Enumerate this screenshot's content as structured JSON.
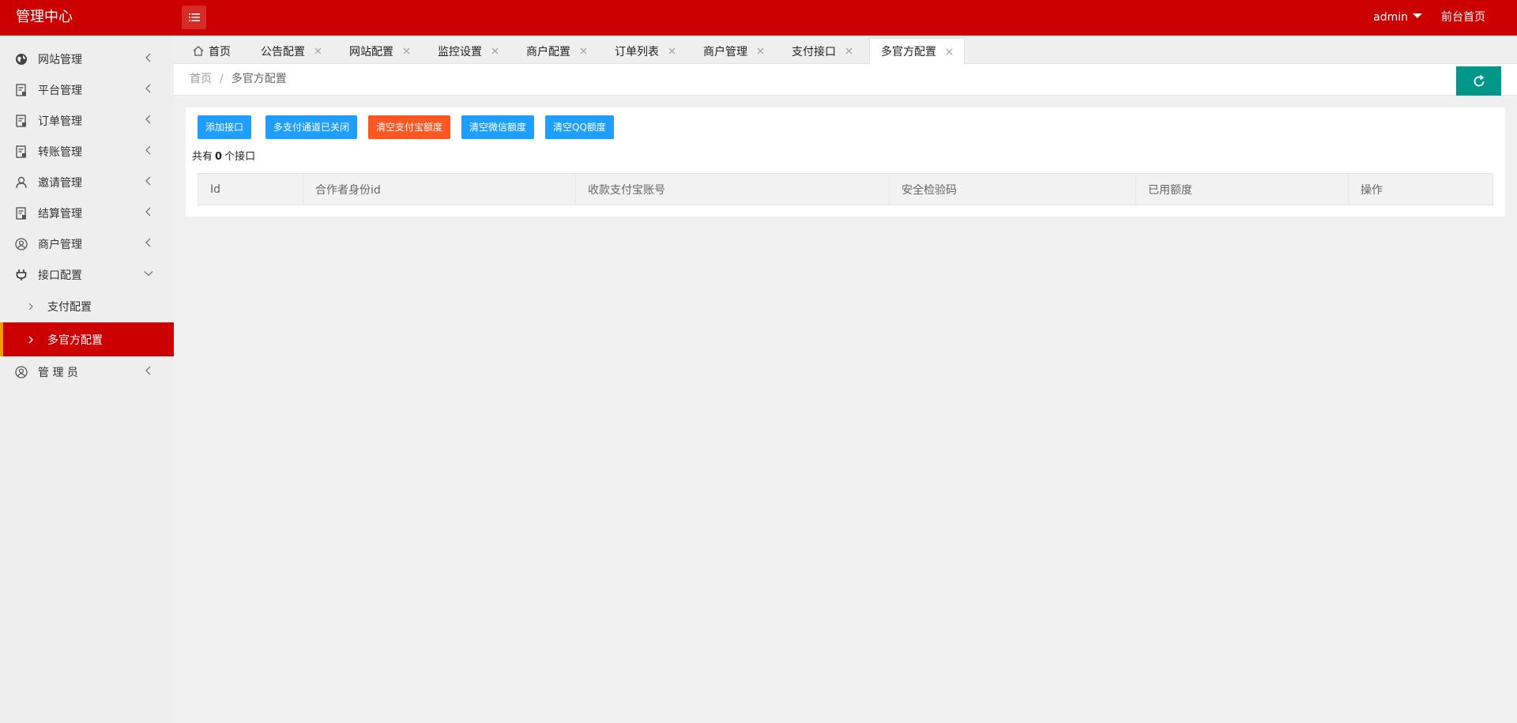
{
  "header": {
    "logo": "管理中心",
    "user": "admin",
    "front_link": "前台首页"
  },
  "sidebar": {
    "items": [
      {
        "label": "网站管理",
        "icon": "globe-icon"
      },
      {
        "label": "平台管理",
        "icon": "document-icon"
      },
      {
        "label": "订单管理",
        "icon": "document-icon"
      },
      {
        "label": "转账管理",
        "icon": "document-icon"
      },
      {
        "label": "邀请管理",
        "icon": "user-icon"
      },
      {
        "label": "结算管理",
        "icon": "document-icon"
      },
      {
        "label": "商户管理",
        "icon": "user-circle-icon"
      },
      {
        "label": "接口配置",
        "icon": "plug-icon"
      }
    ],
    "subitems": [
      {
        "label": "支付配置"
      },
      {
        "label": "多官方配置"
      }
    ],
    "last_item": {
      "label": "管 理 员",
      "icon": "user-circle-icon"
    }
  },
  "tabs": [
    {
      "label": "首页"
    },
    {
      "label": "公告配置"
    },
    {
      "label": "网站配置"
    },
    {
      "label": "监控设置"
    },
    {
      "label": "商户配置"
    },
    {
      "label": "订单列表"
    },
    {
      "label": "商户管理"
    },
    {
      "label": "支付接口"
    },
    {
      "label": "多官方配置"
    }
  ],
  "breadcrumb": {
    "home": "首页",
    "separator": "/",
    "current": "多官方配置"
  },
  "toolbar": {
    "add": "添加接口",
    "multi_pay": "多支付通道已关闭",
    "clear_alipay": "清空支付宝额度",
    "clear_wechat": "清空微信额度",
    "clear_qq": "清空QQ额度"
  },
  "summary": {
    "prefix": "共有",
    "count": "0",
    "suffix": "个接口"
  },
  "table": {
    "columns": [
      "Id",
      "合作者身份id",
      "收款支付宝账号",
      "安全检验码",
      "已用额度",
      "操作"
    ]
  },
  "colors": {
    "brand_red": "#cc0000",
    "active_border": "#ff9900",
    "primary_blue": "#1e9fff",
    "warn_orange": "#ff5722",
    "refresh_green": "#009688"
  }
}
